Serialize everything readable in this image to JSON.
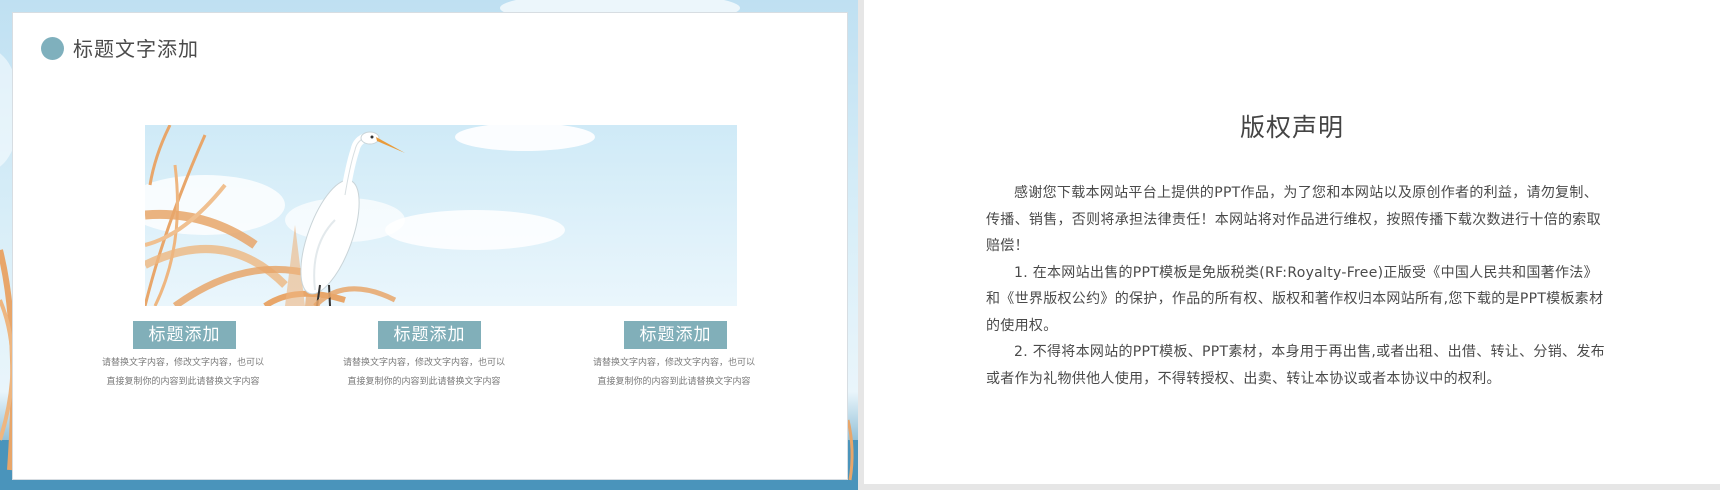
{
  "slide1": {
    "title": "标题文字添加",
    "captions": [
      {
        "label": "标题添加",
        "line1": "请替换文字内容，修改文字内容，也可以",
        "line2": "直接复制你的内容到此请替换文字内容"
      },
      {
        "label": "标题添加",
        "line1": "请替换文字内容，修改文字内容，也可以",
        "line2": "直接复制你的内容到此请替换文字内容"
      },
      {
        "label": "标题添加",
        "line1": "请替换文字内容，修改文字内容，也可以",
        "line2": "直接复制你的内容到此请替换文字内容"
      }
    ],
    "colors": {
      "accent": "#81afb9",
      "dot": "#7fb0bd",
      "reed": "#e8a66a",
      "sky": "#d6eef9"
    }
  },
  "slide2": {
    "title": "版权声明",
    "paragraphs": [
      "感谢您下载本网站平台上提供的PPT作品，为了您和本网站以及原创作者的利益，请勿复制、传播、销售，否则将承担法律责任！本网站将对作品进行维权，按照传播下载次数进行十倍的索取赔偿！",
      "1. 在本网站出售的PPT模板是免版税类(RF:Royalty-Free)正版受《中国人民共和国著作法》和《世界版权公约》的保护，作品的所有权、版权和著作权归本网站所有,您下载的是PPT模板素材的使用权。",
      "2. 不得将本网站的PPT模板、PPT素材，本身用于再出售,或者出租、出借、转让、分销、发布或者作为礼物供他人使用，不得转授权、出卖、转让本协议或者本协议中的权利。"
    ]
  }
}
